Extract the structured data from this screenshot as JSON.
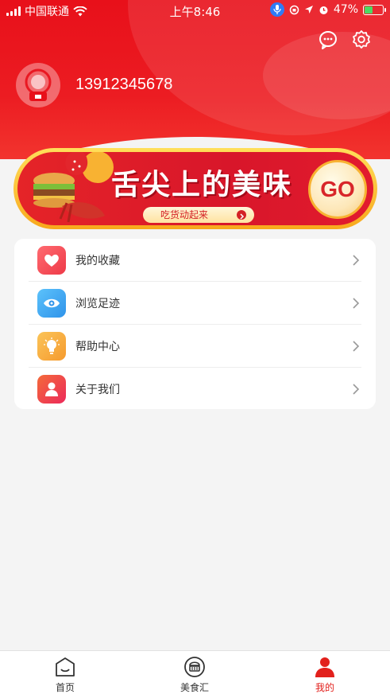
{
  "status_bar": {
    "carrier": "中国联通",
    "time": "上午8:46",
    "battery": "47%",
    "battery_level": 0.47
  },
  "header": {
    "message_icon": "chat-bubble-icon",
    "settings_icon": "gear-icon",
    "phone": "13912345678"
  },
  "banner": {
    "title": "舌尖上的美味",
    "subtitle": "吃货动起来",
    "go_label": "GO"
  },
  "menu": {
    "items": [
      {
        "label": "我的收藏",
        "icon": "heart-icon",
        "color": "#f0444e"
      },
      {
        "label": "浏览足迹",
        "icon": "eye-icon",
        "color": "#3aa6f1"
      },
      {
        "label": "帮助中心",
        "icon": "lightbulb-icon",
        "color": "#f7a43b"
      },
      {
        "label": "关于我们",
        "icon": "person-icon",
        "color": "#f0384a"
      }
    ]
  },
  "tabbar": {
    "tabs": [
      {
        "label": "首页",
        "icon": "home-icon",
        "active": false
      },
      {
        "label": "美食汇",
        "icon": "food-icon",
        "active": false
      },
      {
        "label": "我的",
        "icon": "profile-icon",
        "active": true
      }
    ]
  },
  "colors": {
    "brand_red": "#e8101a",
    "active_tab": "#e2201c"
  }
}
